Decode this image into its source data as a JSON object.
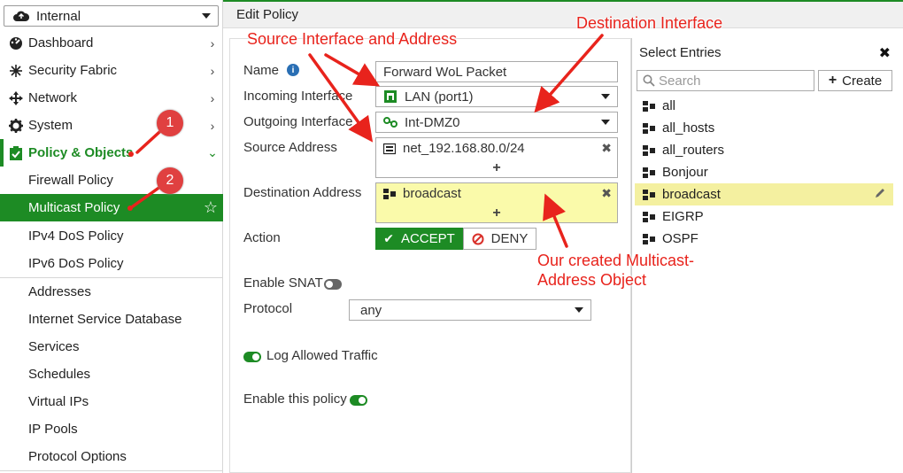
{
  "vdom": {
    "label": "Internal"
  },
  "sidebar": {
    "items": [
      {
        "label": "Dashboard",
        "icon": "dashboard-icon"
      },
      {
        "label": "Security Fabric",
        "icon": "security-fabric-icon"
      },
      {
        "label": "Network",
        "icon": "network-icon"
      },
      {
        "label": "System",
        "icon": "gear-icon"
      },
      {
        "label": "Policy & Objects",
        "icon": "policy-icon"
      }
    ],
    "policy_subitems": [
      "Firewall Policy",
      "Multicast Policy",
      "IPv4 DoS Policy",
      "IPv6 DoS Policy"
    ],
    "object_subitems": [
      "Addresses",
      "Internet Service Database",
      "Services",
      "Schedules",
      "Virtual IPs",
      "IP Pools",
      "Protocol Options"
    ]
  },
  "header": {
    "title": "Edit Policy"
  },
  "form": {
    "name_label": "Name",
    "name_value": "Forward WoL Packet",
    "incoming_label": "Incoming Interface",
    "incoming_value": "LAN (port1)",
    "outgoing_label": "Outgoing Interface",
    "outgoing_value": "Int-DMZ0",
    "source_label": "Source Address",
    "source_value": "net_192.168.80.0/24",
    "destination_label": "Destination Address",
    "destination_value": "broadcast",
    "action_label": "Action",
    "accept_label": "ACCEPT",
    "deny_label": "DENY",
    "snat_label": "Enable SNAT",
    "protocol_label": "Protocol",
    "protocol_value": "any",
    "log_label": "Log Allowed Traffic",
    "enable_label": "Enable this policy",
    "plus": "+"
  },
  "entries_panel": {
    "title": "Select Entries",
    "search_placeholder": "Search",
    "create_label": "Create",
    "items": [
      "all",
      "all_hosts",
      "all_routers",
      "Bonjour",
      "broadcast",
      "EIGRP",
      "OSPF"
    ],
    "selected": "broadcast"
  },
  "annotations": {
    "source_interface": "Source Interface and Address",
    "destination_interface": "Destination Interface",
    "multicast_object_line1": "Our created Multicast-",
    "multicast_object_line2": "Address Object",
    "badge1": "1",
    "badge2": "2"
  },
  "colors": {
    "accent": "#1d8b24",
    "annotation": "#e8231c",
    "highlight": "#fafaaa"
  }
}
